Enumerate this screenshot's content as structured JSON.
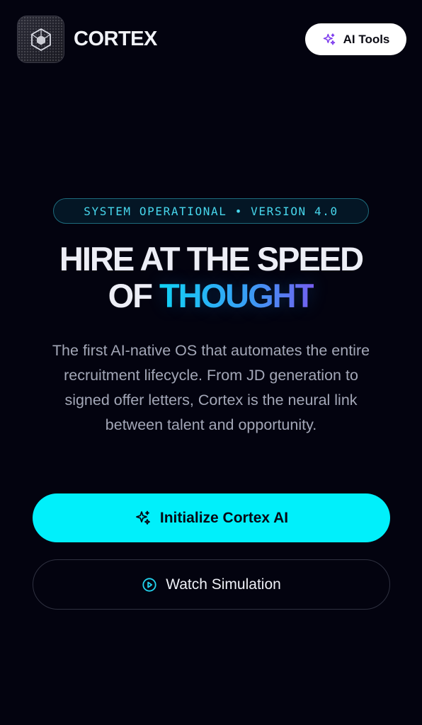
{
  "header": {
    "brand": "CORTEX",
    "logo_icon": "hexagon-cube-icon",
    "ai_tools_button": {
      "label": "AI Tools",
      "icon": "sparkles-icon",
      "icon_color": "#7c3aed"
    }
  },
  "hero": {
    "status_pill": "SYSTEM OPERATIONAL • VERSION 4.0",
    "headline": {
      "line1": "HIRE AT THE SPEED",
      "line2_prefix": "OF ",
      "line2_accent": "THOUGHT"
    },
    "description": "The first AI-native OS that automates the entire recruitment lifecycle. From JD generation to signed offer letters, Cortex is the neural link between talent and opportunity."
  },
  "actions": {
    "primary": {
      "label": "Initialize Cortex AI",
      "icon": "sparkles-icon",
      "background": "#00f0fb"
    },
    "secondary": {
      "label": "Watch Simulation",
      "icon": "play-circle-icon",
      "icon_color": "#22d3ee"
    }
  },
  "colors": {
    "background": "#03030f",
    "accent_cyan": "#00f0fb",
    "status_text": "#47d6ec"
  }
}
